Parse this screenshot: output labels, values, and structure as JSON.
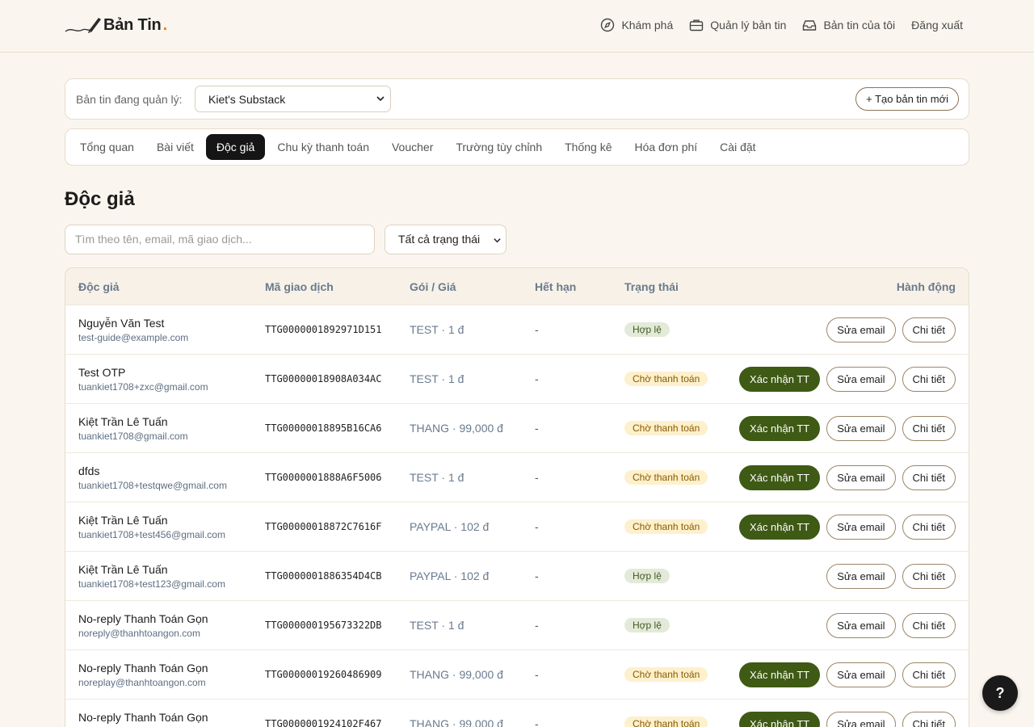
{
  "header": {
    "brand": "Bản Tin",
    "brand_dot": ".",
    "nav": [
      {
        "label": "Khám phá",
        "icon": "compass-icon"
      },
      {
        "label": "Quản lý bản tin",
        "icon": "briefcase-icon"
      },
      {
        "label": "Bản tin của tôi",
        "icon": "inbox-icon"
      },
      {
        "label": "Đăng xuất",
        "icon": ""
      }
    ]
  },
  "manager": {
    "label": "Bản tin đang quản lý:",
    "selected": "Kiet's Substack",
    "create_label": "+ Tạo bản tin mới"
  },
  "tabs": [
    {
      "label": "Tổng quan",
      "active": false
    },
    {
      "label": "Bài viết",
      "active": false
    },
    {
      "label": "Độc giả",
      "active": true
    },
    {
      "label": "Chu kỳ thanh toán",
      "active": false
    },
    {
      "label": "Voucher",
      "active": false
    },
    {
      "label": "Trường tùy chỉnh",
      "active": false
    },
    {
      "label": "Thống kê",
      "active": false
    },
    {
      "label": "Hóa đơn phí",
      "active": false
    },
    {
      "label": "Cài đặt",
      "active": false
    }
  ],
  "page": {
    "title": "Độc giả"
  },
  "filters": {
    "search_placeholder": "Tìm theo tên, email, mã giao dịch...",
    "status_selected": "Tất cả trạng thái"
  },
  "table": {
    "columns": {
      "reader": "Độc giả",
      "txn": "Mã giao dịch",
      "plan": "Gói / Giá",
      "expiry": "Hết hạn",
      "status": "Trạng thái",
      "actions": "Hành động"
    },
    "buttons": {
      "confirm": "Xác nhận TT",
      "edit_email": "Sửa email",
      "detail": "Chi tiết"
    },
    "rows": [
      {
        "name": "Nguyễn Văn Test",
        "email": "test-guide@example.com",
        "txn": "TTG0000001892971D151",
        "plan": "TEST · 1 đ",
        "expiry": "-",
        "status": "Hợp lệ",
        "pending": false
      },
      {
        "name": "Test OTP",
        "email": "tuankiet1708+zxc@gmail.com",
        "txn": "TTG00000018908A034AC",
        "plan": "TEST · 1 đ",
        "expiry": "-",
        "status": "Chờ thanh toán",
        "pending": true
      },
      {
        "name": "Kiệt Trần Lê Tuấn",
        "email": "tuankiet1708@gmail.com",
        "txn": "TTG00000018895B16CA6",
        "plan": "THANG · 99,000 đ",
        "expiry": "-",
        "status": "Chờ thanh toán",
        "pending": true
      },
      {
        "name": "dfds",
        "email": "tuankiet1708+testqwe@gmail.com",
        "txn": "TTG0000001888A6F5006",
        "plan": "TEST · 1 đ",
        "expiry": "-",
        "status": "Chờ thanh toán",
        "pending": true
      },
      {
        "name": "Kiệt Trần Lê Tuấn",
        "email": "tuankiet1708+test456@gmail.com",
        "txn": "TTG00000018872C7616F",
        "plan": "PAYPAL · 102 đ",
        "expiry": "-",
        "status": "Chờ thanh toán",
        "pending": true
      },
      {
        "name": "Kiệt Trần Lê Tuấn",
        "email": "tuankiet1708+test123@gmail.com",
        "txn": "TTG0000001886354D4CB",
        "plan": "PAYPAL · 102 đ",
        "expiry": "-",
        "status": "Hợp lệ",
        "pending": false
      },
      {
        "name": "No-reply Thanh Toán Gọn",
        "email": "noreply@thanhtoangon.com",
        "txn": "TTG000000195673322DB",
        "plan": "TEST · 1 đ",
        "expiry": "-",
        "status": "Hợp lệ",
        "pending": false
      },
      {
        "name": "No-reply Thanh Toán Gọn",
        "email": "noreplay@thanhtoangon.com",
        "txn": "TTG00000019260486909",
        "plan": "THANG · 99,000 đ",
        "expiry": "-",
        "status": "Chờ thanh toán",
        "pending": true
      },
      {
        "name": "No-reply Thanh Toán Gọn",
        "email": "",
        "txn": "TTG0000001924102F467",
        "plan": "THANG · 99,000 đ",
        "expiry": "-",
        "status": "Chờ thanh toán",
        "pending": true
      }
    ]
  },
  "help": {
    "label": "?"
  },
  "colors": {
    "background": "#faf6ef",
    "accent_dark": "#151515",
    "confirm_green": "#3e5a14",
    "brand_dot": "#e8821c",
    "valid_badge": "#e4ead9",
    "pending_badge": "#fdf0cc"
  }
}
